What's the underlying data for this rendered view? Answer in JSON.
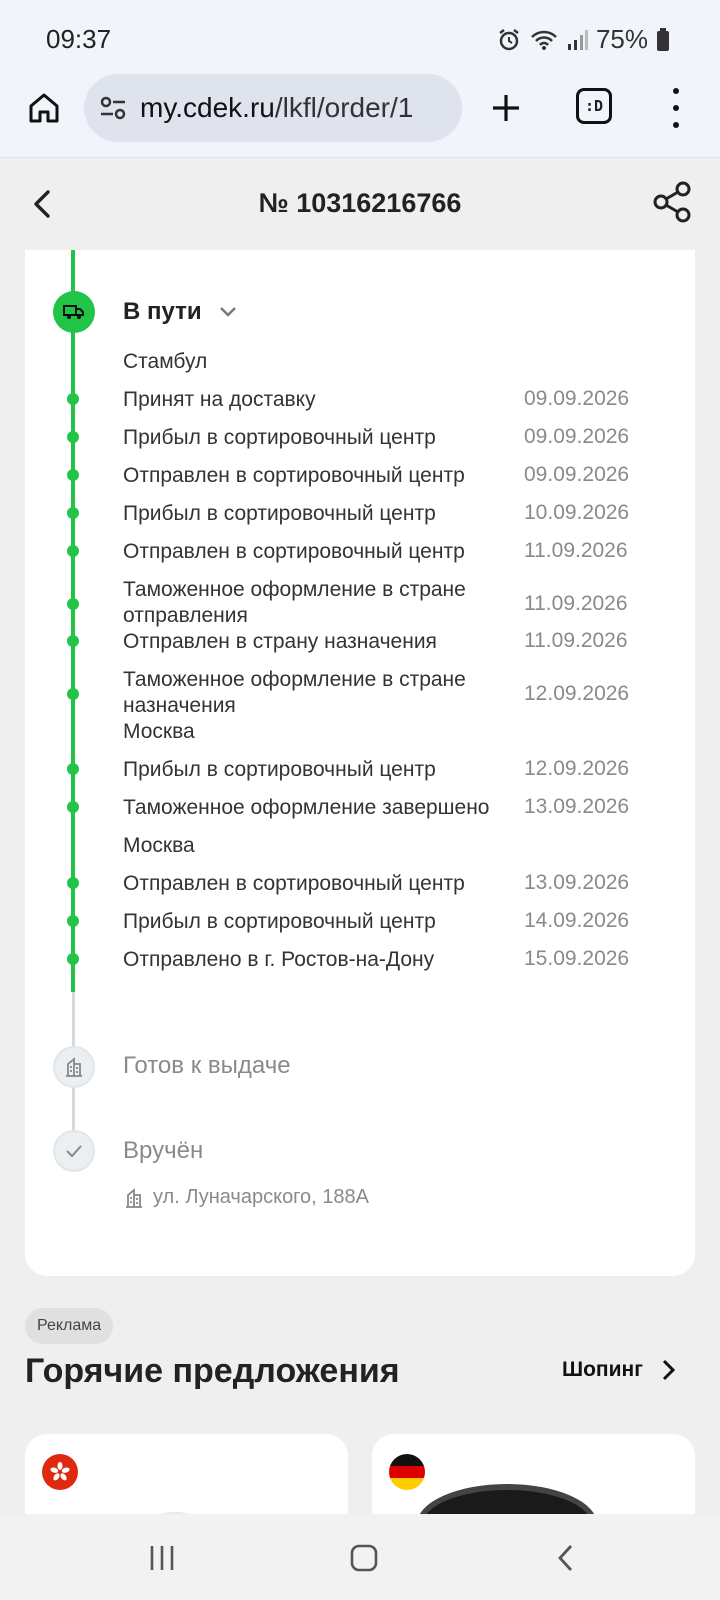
{
  "status_bar": {
    "time": "09:37",
    "battery": "75%"
  },
  "browser": {
    "url_host": "my.cdek.ru",
    "url_path": "/lkfl/order/1",
    "tabs_label": ":D"
  },
  "header": {
    "order_title": "№ 10316216766"
  },
  "tracking": {
    "current_stage": "В пути",
    "groups": [
      {
        "city": "Стамбул",
        "events": [
          {
            "text": "Принят на доставку",
            "date": "09.09.2026"
          },
          {
            "text": "Прибыл в сортировочный центр",
            "date": "09.09.2026"
          },
          {
            "text": "Отправлен в сортировочный центр",
            "date": "09.09.2026"
          },
          {
            "text": "Прибыл в сортировочный центр",
            "date": "10.09.2026"
          },
          {
            "text": "Отправлен в сортировочный центр",
            "date": "11.09.2026"
          },
          {
            "text": "Таможенное оформление в стране отправления",
            "date": "11.09.2026"
          },
          {
            "text": "Отправлен в страну назначения",
            "date": "11.09.2026"
          },
          {
            "text": "Таможенное оформление в стране назначения",
            "date": "12.09.2026"
          }
        ]
      },
      {
        "city": "Москва",
        "events": [
          {
            "text": "Прибыл в сортировочный центр",
            "date": "12.09.2026"
          },
          {
            "text": "Таможенное оформление завершено",
            "date": "13.09.2026"
          }
        ]
      },
      {
        "city": "Москва",
        "events": [
          {
            "text": "Отправлен в сортировочный центр",
            "date": "13.09.2026"
          },
          {
            "text": "Прибыл в сортировочный центр",
            "date": "14.09.2026"
          },
          {
            "text": "Отправлено в г. Ростов-на-Дону",
            "date": "15.09.2026"
          }
        ]
      }
    ],
    "ready_stage": "Готов к выдаче",
    "delivered_stage": "Вручён",
    "address": "ул. Луначарского, 188А"
  },
  "ads": {
    "badge": "Реклама",
    "title": "Горячие предложения",
    "shop_link": "Шопинг"
  },
  "colors": {
    "accent_green": "#22c447",
    "card_bg": "#ffffff",
    "page_bg": "#efefef"
  }
}
